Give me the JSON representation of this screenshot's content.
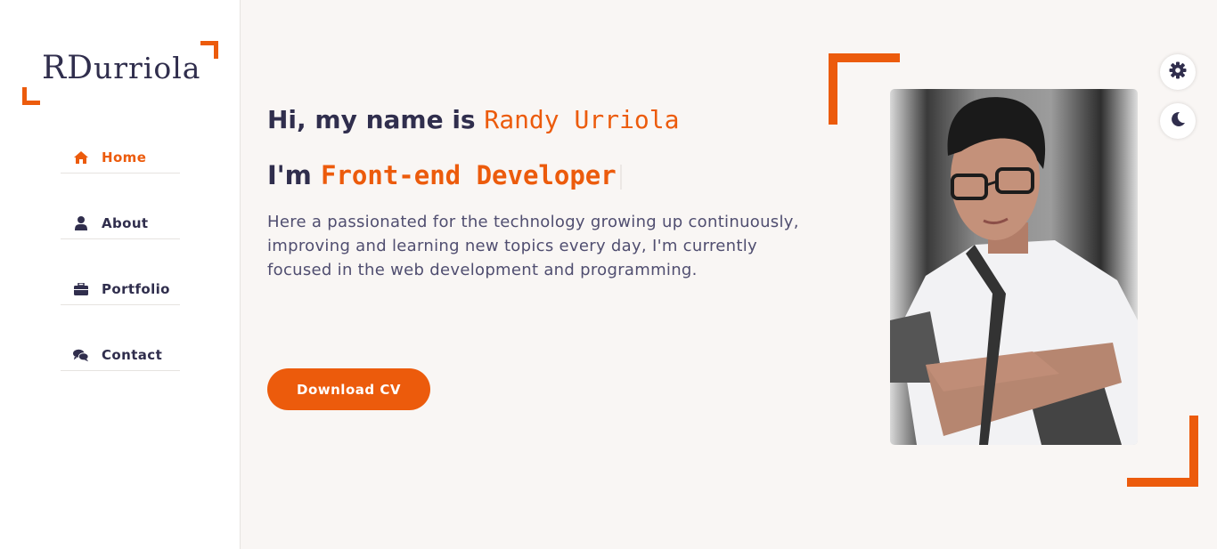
{
  "logo": {
    "text_initials": "RD",
    "text_rest": "urriola"
  },
  "nav": {
    "items": [
      {
        "label": "Home",
        "icon": "home-icon",
        "active": true
      },
      {
        "label": "About",
        "icon": "user-icon",
        "active": false
      },
      {
        "label": "Portfolio",
        "icon": "briefcase-icon",
        "active": false
      },
      {
        "label": "Contact",
        "icon": "comments-icon",
        "active": false
      }
    ]
  },
  "hero": {
    "greeting_prefix": "Hi, my name is",
    "name": "Randy Urriola",
    "role_prefix": "I'm",
    "role": "Front-end Developer",
    "intro": "Here a passionated for the technology growing up continuously, improving and learning new topics every day, I'm currently focused in the web development and programming.",
    "cv_button": "Download CV"
  },
  "controls": {
    "settings_icon": "gear-icon",
    "theme_icon": "moon-icon"
  },
  "colors": {
    "accent": "#ec5b0c",
    "text": "#302e4d",
    "background": "#f9f6f4"
  }
}
